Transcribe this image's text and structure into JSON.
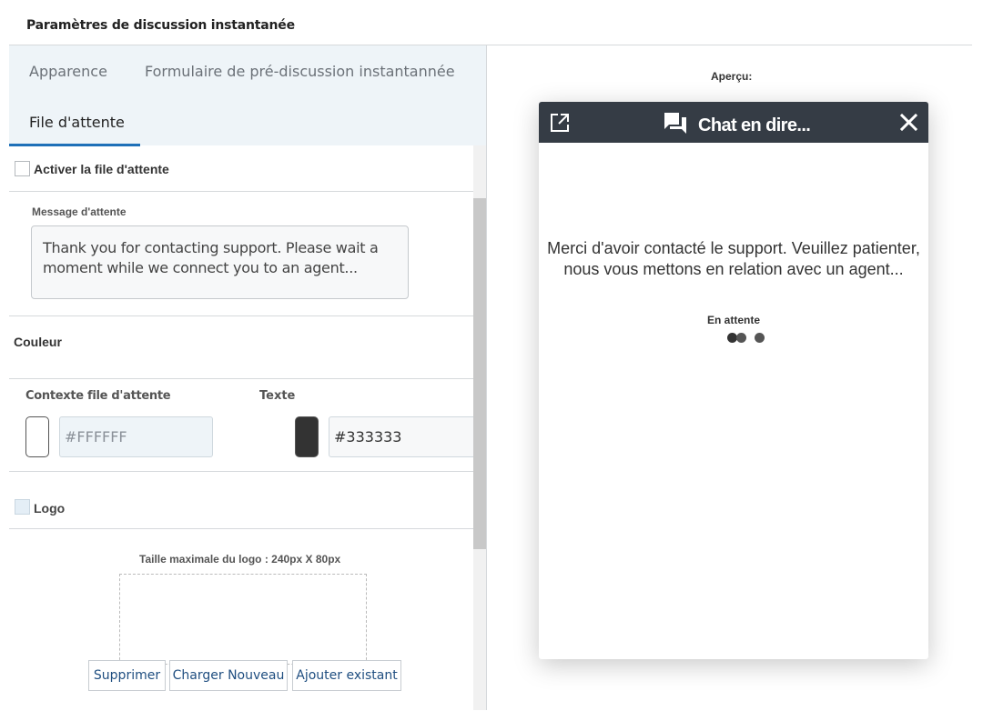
{
  "header": {
    "title": "Paramètres de discussion instantanée"
  },
  "tabs": [
    {
      "label": "Apparence",
      "active": false
    },
    {
      "label": "Formulaire de pré-discussion instantannée",
      "active": false
    },
    {
      "label": "File d'attente",
      "active": true
    }
  ],
  "queue": {
    "enable_label": "Activer la file d'attente",
    "enabled": false,
    "message_label": "Message d'attente",
    "message_value": "Thank you for contacting support. Please wait a moment while we connect you to an agent..."
  },
  "color": {
    "section_label": "Couleur",
    "background_label": "Contexte file d'attente",
    "background_value": "#FFFFFF",
    "text_label": "Texte",
    "text_value": "#333333"
  },
  "logo": {
    "label": "Logo",
    "enabled": false,
    "size_hint": "Taille maximale du logo : 240px X 80px",
    "buttons": {
      "remove": "Supprimer",
      "upload": "Charger Nouveau",
      "add_existing": "Ajouter existant"
    }
  },
  "preview": {
    "label": "Aperçu:",
    "chat_title": "Chat en dire...",
    "message": "Merci d'avoir contacté le support. Veuillez patienter, nous vous mettons en relation avec un agent...",
    "status": "En attente",
    "header_color": "#353C45"
  },
  "icons": [
    "checkbox-icon",
    "popout-icon",
    "chat-bubble-icon",
    "close-icon",
    "typing-dots-icon"
  ]
}
